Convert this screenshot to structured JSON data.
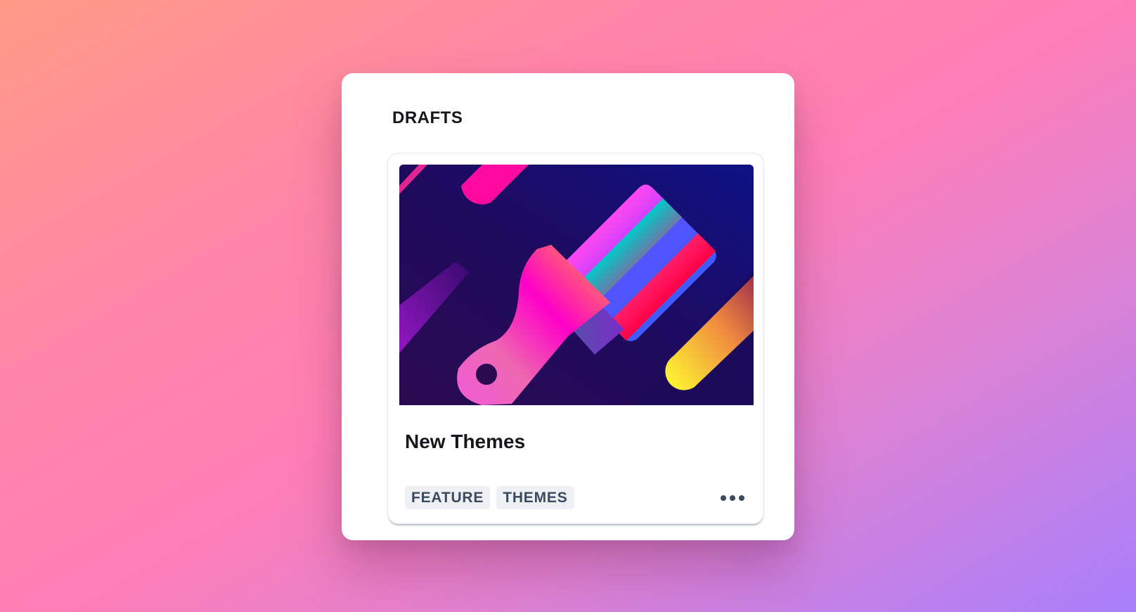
{
  "section": {
    "title": "DRAFTS"
  },
  "post": {
    "title": "New Themes",
    "cover_icon": "paintbrush-illustration",
    "tags": [
      "FEATURE",
      "THEMES"
    ],
    "menu_icon": "more-horizontal-icon"
  },
  "colors": {
    "tag_background": "#eef0f3",
    "tag_text": "#3a4a60",
    "cover_background": "#240d5a"
  }
}
